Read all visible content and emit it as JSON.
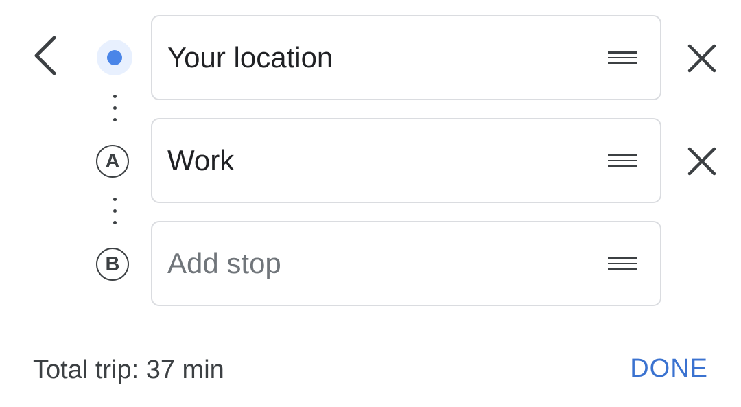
{
  "navigation": {
    "back_icon": "chevron-left-icon"
  },
  "route": {
    "origin": {
      "marker_icon": "current-location-dot-icon",
      "value": "Your location"
    },
    "stops": [
      {
        "marker_letter": "A",
        "value": "Work",
        "placeholder": ""
      },
      {
        "marker_letter": "B",
        "value": "",
        "placeholder": "Add stop"
      }
    ],
    "drag_icon": "drag-handle-icon",
    "remove_icon": "close-icon"
  },
  "footer": {
    "total_trip": "Total trip: 37 min",
    "done_label": "DONE"
  },
  "colors": {
    "accent": "#3a72d0",
    "location_dot": "#4a85e8",
    "location_halo": "#e8f0fe",
    "field_border": "#dadce0",
    "text": "#202124",
    "placeholder": "#70757a"
  }
}
